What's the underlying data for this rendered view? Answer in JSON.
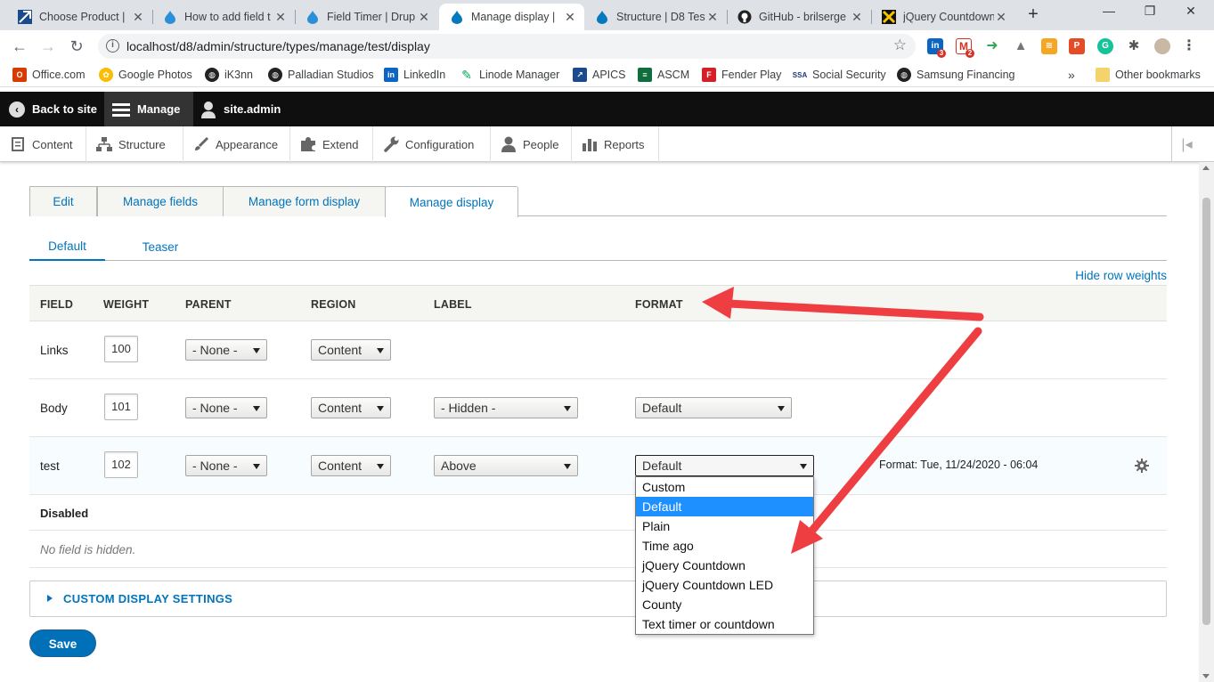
{
  "browser": {
    "tabs": [
      {
        "title": "Choose Product |",
        "icon": "arrow-logo-icon"
      },
      {
        "title": "How to add field t",
        "icon": "drupal-drop-icon"
      },
      {
        "title": "Field Timer | Drup",
        "icon": "drupal-drop-icon"
      },
      {
        "title": "Manage display | ",
        "icon": "drupal-drop-icon"
      },
      {
        "title": "Structure | D8 Test",
        "icon": "drupal-drop-icon"
      },
      {
        "title": "GitHub - brilserge",
        "icon": "github-icon"
      },
      {
        "title": "jQuery Countdown",
        "icon": "countdown-site-icon"
      }
    ],
    "url": "localhost/d8/admin/structure/types/manage/test/display",
    "extension_badges": {
      "linkedin": "3",
      "gmail": "2"
    },
    "bookmarks": [
      "Office.com",
      "Google Photos",
      "iK3nn",
      "Palladian Studios",
      "LinkedIn",
      "Linode Manager",
      "APICS",
      "ASCM",
      "Fender Play",
      "Social Security",
      "Samsung Financing"
    ],
    "bookmarks_overflow": "»",
    "other_bookmarks": "Other bookmarks"
  },
  "admin": {
    "back_to_site": "Back to site",
    "manage": "Manage",
    "user": "site.admin",
    "menu": [
      "Content",
      "Structure",
      "Appearance",
      "Extend",
      "Configuration",
      "People",
      "Reports"
    ]
  },
  "page": {
    "primary_tabs": [
      "Edit",
      "Manage fields",
      "Manage form display",
      "Manage display"
    ],
    "secondary_tabs": [
      "Default",
      "Teaser"
    ],
    "hide_row_weights": "Hide row weights",
    "columns": [
      "FIELD",
      "WEIGHT",
      "PARENT",
      "REGION",
      "LABEL",
      "FORMAT"
    ],
    "rows": [
      {
        "field": "Links",
        "weight": "100",
        "parent": "- None -",
        "region": "Content",
        "label": "",
        "format": "",
        "summary": ""
      },
      {
        "field": "Body",
        "weight": "101",
        "parent": "- None -",
        "region": "Content",
        "label": "- Hidden -",
        "format": "Default",
        "summary": ""
      },
      {
        "field": "test",
        "weight": "102",
        "parent": "- None -",
        "region": "Content",
        "label": "Above",
        "format": "Default",
        "summary": "Format: Tue, 11/24/2020 - 06:04"
      }
    ],
    "disabled_title": "Disabled",
    "no_field_hidden": "No field is hidden.",
    "custom_display_settings": "CUSTOM DISPLAY SETTINGS",
    "save": "Save"
  },
  "format_dropdown": {
    "options": [
      "Custom",
      "Default",
      "Plain",
      "Time ago",
      "jQuery Countdown",
      "jQuery Countdown LED",
      "County",
      "Text timer or countdown"
    ],
    "selected": "Default"
  },
  "colors": {
    "link_blue": "#0074bd",
    "annotation_red": "#ef3e42",
    "selected_option": "#1e90ff"
  }
}
